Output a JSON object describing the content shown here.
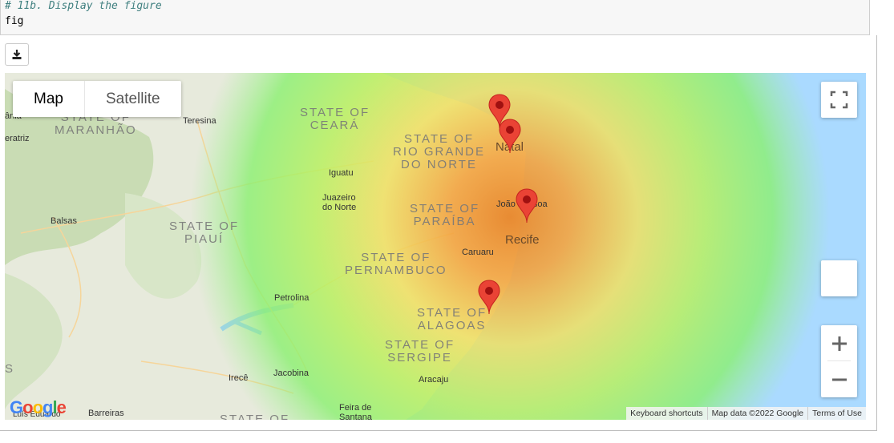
{
  "code_cell": {
    "comment": "# 11b. Display the figure",
    "code": "fig"
  },
  "toolbar": {
    "download_icon": "download-icon"
  },
  "map_type": {
    "map_label": "Map",
    "satellite_label": "Satellite"
  },
  "states": [
    {
      "name": "STATE OF",
      "name2": "MARANHÃO"
    },
    {
      "name": "STATE OF",
      "name2": "CEARÁ"
    },
    {
      "name": "STATE OF",
      "name2": "PIAUÍ"
    },
    {
      "name": "STATE OF",
      "name2": "RIO GRANDE",
      "name3": "DO NORTE"
    },
    {
      "name": "STATE OF",
      "name2": "PARAÍBA"
    },
    {
      "name": "STATE OF",
      "name2": "PERNAMBUCO"
    },
    {
      "name": "STATE OF",
      "name2": "ALAGOAS"
    },
    {
      "name": "STATE OF",
      "name2": "SERGIPE"
    },
    {
      "name": "STATE OF",
      "name2": ""
    }
  ],
  "cities": {
    "teresina": "Teresina",
    "balsas": "Balsas",
    "iguatu": "Iguatu",
    "juazeiro": "Juazeiro",
    "juazeiro2": "do Norte",
    "petrolina": "Petrolina",
    "caruaru": "Caruaru",
    "aracaju": "Aracaju",
    "jacobina": "Jacobina",
    "irece": "Irecê",
    "feira": "Feira de",
    "feira2": "Santana",
    "barreiras": "Barreiras",
    "luis": "Luís Eduardo",
    "natal": "Natal",
    "joao_pessoa": "João Pessoa",
    "recife": "Recife",
    "left_edge_1": "ânia",
    "left_edge_2": "eratriz",
    "left_edge_3": "S"
  },
  "attribution": {
    "shortcuts": "Keyboard shortcuts",
    "map_data": "Map data ©2022 Google",
    "terms": "Terms of Use"
  },
  "logo_text": "Google",
  "colors": {
    "marker": "#ea4335",
    "marker_dot": "#a01010",
    "water": "#aadaff"
  }
}
